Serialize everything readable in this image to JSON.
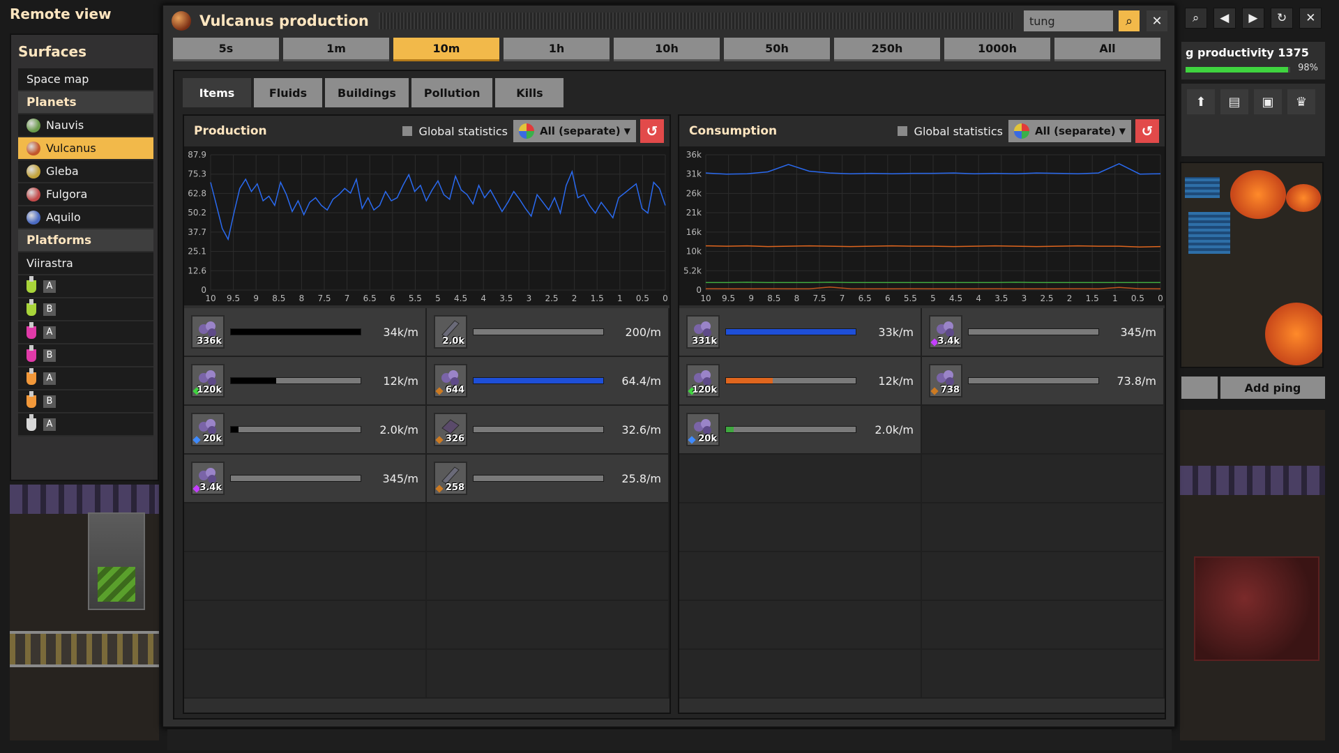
{
  "remote_title": "Remote view",
  "surfaces": {
    "title": "Surfaces",
    "space_map": "Space map",
    "planets_header": "Planets",
    "planets": [
      {
        "name": "Nauvis",
        "color": "#6a9a4a"
      },
      {
        "name": "Vulcanus",
        "color": "#c2562a",
        "selected": true
      },
      {
        "name": "Gleba",
        "color": "#c2a23a"
      },
      {
        "name": "Fulgora",
        "color": "#c24a4a"
      },
      {
        "name": "Aquilo",
        "color": "#4a6ac2"
      }
    ],
    "platforms_header": "Platforms",
    "platform_name": "Viirastra",
    "platform_items": [
      {
        "letter": "A",
        "color": "#a8d43a"
      },
      {
        "letter": "B",
        "color": "#a8d43a"
      },
      {
        "letter": "A",
        "color": "#e03aa8"
      },
      {
        "letter": "B",
        "color": "#e03aa8"
      },
      {
        "letter": "A",
        "color": "#f2983a"
      },
      {
        "letter": "B",
        "color": "#f2983a"
      },
      {
        "letter": "A",
        "color": "#d8d8d8"
      }
    ]
  },
  "window": {
    "title": "Vulcanus production",
    "search_value": "tung",
    "search_icon": "search-icon",
    "close_icon": "close-icon"
  },
  "time_ranges": [
    {
      "label": "5s"
    },
    {
      "label": "1m"
    },
    {
      "label": "10m",
      "selected": true
    },
    {
      "label": "1h"
    },
    {
      "label": "10h"
    },
    {
      "label": "50h"
    },
    {
      "label": "250h"
    },
    {
      "label": "1000h"
    },
    {
      "label": "All"
    }
  ],
  "tabs": [
    {
      "label": "Items",
      "selected": true
    },
    {
      "label": "Fluids"
    },
    {
      "label": "Buildings"
    },
    {
      "label": "Pollution"
    },
    {
      "label": "Kills"
    }
  ],
  "production": {
    "title": "Production",
    "global_label": "Global statistics",
    "dropdown": "All (separate)",
    "rows": [
      [
        {
          "amount": "336k",
          "fill": 1.0,
          "fill_color": "#000000",
          "rate": "34k/m",
          "icon": "ore"
        },
        {
          "amount": "2.0k",
          "fill": 0.0,
          "fill_color": "#1e4fd8",
          "rate": "200/m",
          "icon": "plate"
        }
      ],
      [
        {
          "amount": "120k",
          "fill": 0.35,
          "fill_color": "#000000",
          "rate": "12k/m",
          "icon": "ore",
          "quality": "green"
        },
        {
          "amount": "644",
          "fill": 1.0,
          "fill_color": "#1e4fd8",
          "rate": "64.4/m",
          "icon": "ore",
          "quality": "orange"
        }
      ],
      [
        {
          "amount": "20k",
          "fill": 0.06,
          "fill_color": "#000000",
          "rate": "2.0k/m",
          "icon": "ore",
          "quality": "blue"
        },
        {
          "amount": "326",
          "fill": 0.0,
          "fill_color": "#1e4fd8",
          "rate": "32.6/m",
          "icon": "carbide",
          "quality": "orange"
        }
      ],
      [
        {
          "amount": "3.4k",
          "fill": 0.0,
          "fill_color": "#000000",
          "rate": "345/m",
          "icon": "ore",
          "quality": "purple"
        },
        {
          "amount": "258",
          "fill": 0.0,
          "fill_color": "#1e4fd8",
          "rate": "25.8/m",
          "icon": "plate",
          "quality": "orange"
        }
      ]
    ],
    "chart": {
      "y_ticks": [
        "87.9",
        "75.3",
        "62.8",
        "50.2",
        "37.7",
        "25.1",
        "12.6",
        "0"
      ],
      "x_ticks": [
        "10",
        "9.5",
        "9",
        "8.5",
        "8",
        "7.5",
        "7",
        "6.5",
        "6",
        "5.5",
        "5",
        "4.5",
        "4",
        "3.5",
        "3",
        "2.5",
        "2",
        "1.5",
        "1",
        "0.5",
        "0"
      ],
      "ymax": 87.9,
      "series": [
        {
          "color": "#2a6af0",
          "values": [
            70,
            55,
            40,
            33,
            50,
            66,
            72,
            64,
            69,
            58,
            61,
            55,
            70,
            62,
            51,
            58,
            49,
            57,
            60,
            55,
            52,
            59,
            62,
            66,
            63,
            72,
            53,
            60,
            52,
            55,
            64,
            58,
            60,
            68,
            75,
            64,
            68,
            58,
            65,
            71,
            62,
            59,
            74,
            65,
            62,
            56,
            68,
            60,
            65,
            58,
            51,
            57,
            64,
            59,
            53,
            48,
            62,
            57,
            52,
            60,
            50,
            68,
            77,
            60,
            62,
            55,
            50,
            57,
            52,
            47,
            60,
            63,
            66,
            69,
            53,
            50,
            70,
            66,
            55
          ]
        }
      ]
    }
  },
  "consumption": {
    "title": "Consumption",
    "global_label": "Global statistics",
    "dropdown": "All (separate)",
    "rows": [
      [
        {
          "amount": "331k",
          "fill": 1.0,
          "fill_color": "#1e4fd8",
          "rate": "33k/m",
          "icon": "ore"
        },
        {
          "amount": "3.4k",
          "fill": 0.0,
          "fill_color": "#1e4fd8",
          "rate": "345/m",
          "icon": "ore",
          "quality": "purple"
        }
      ],
      [
        {
          "amount": "120k",
          "fill": 0.36,
          "fill_color": "#e0661e",
          "rate": "12k/m",
          "icon": "ore",
          "quality": "green"
        },
        {
          "amount": "738",
          "fill": 0.0,
          "fill_color": "#1e4fd8",
          "rate": "73.8/m",
          "icon": "ore",
          "quality": "orange"
        }
      ],
      [
        {
          "amount": "20k",
          "fill": 0.06,
          "fill_color": "#3fa83f",
          "rate": "2.0k/m",
          "icon": "ore",
          "quality": "blue"
        },
        null
      ]
    ],
    "chart": {
      "y_ticks": [
        "36k",
        "31k",
        "26k",
        "21k",
        "16k",
        "10k",
        "5.2k",
        "0"
      ],
      "x_ticks": [
        "10",
        "9.5",
        "9",
        "8.5",
        "8",
        "7.5",
        "7",
        "6.5",
        "6",
        "5.5",
        "5",
        "4.5",
        "4",
        "3.5",
        "3",
        "2.5",
        "2",
        "1.5",
        "1",
        "0.5",
        "0"
      ],
      "ymax": 36400,
      "series": [
        {
          "color": "#2a6af0",
          "values": [
            31500,
            31200,
            31300,
            31800,
            33800,
            32000,
            31500,
            31300,
            31400,
            31300,
            31400,
            31400,
            31500,
            31300,
            31400,
            31300,
            31500,
            31400,
            31300,
            31500,
            34000,
            31200,
            31300
          ]
        },
        {
          "color": "#e0661e",
          "values": [
            11900,
            11800,
            11900,
            11700,
            11800,
            11900,
            11800,
            11700,
            11800,
            11900,
            11800,
            11800,
            11700,
            11800,
            11900,
            11800,
            11700,
            11800,
            11900,
            11800,
            11800,
            11600,
            11700
          ]
        },
        {
          "color": "#3fa83f",
          "values": [
            2000,
            2000,
            2100,
            2000,
            2000,
            2000,
            2100,
            2000,
            2000,
            2000,
            2000,
            2000,
            2000,
            2000,
            2000,
            2100,
            2000,
            2000,
            2000,
            2000,
            2000,
            2000,
            2000
          ]
        },
        {
          "color": "#c2561e",
          "values": [
            350,
            330,
            340,
            350,
            320,
            340,
            800,
            350,
            340,
            330,
            350,
            340,
            340,
            330,
            350,
            340,
            330,
            340,
            350,
            340,
            700,
            350,
            340
          ]
        }
      ]
    }
  },
  "hud": {
    "research_name": "g productivity 1375",
    "research_progress": 0.98,
    "research_pct": "98%",
    "add_ping": "Add ping",
    "top_icons": [
      "search-icon",
      "back-icon",
      "forward-icon",
      "refresh-icon",
      "close-icon"
    ],
    "icons": [
      "upload-icon",
      "book-icon",
      "train-icon",
      "trophy-icon"
    ]
  }
}
